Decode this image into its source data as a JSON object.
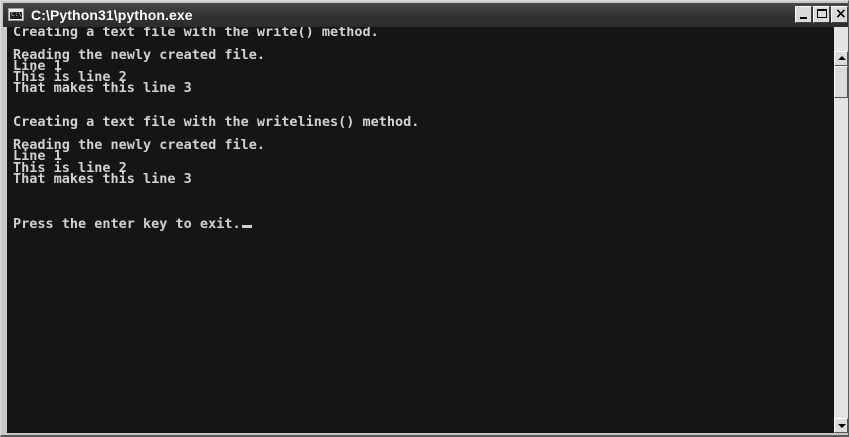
{
  "window": {
    "title": "C:\\Python31\\python.exe",
    "icon_name": "console-app-icon",
    "icon_text": "C:\\",
    "buttons": {
      "minimize_glyph": "",
      "maximize_glyph": "",
      "close_glyph": "×"
    }
  },
  "console": {
    "lines": [
      "Creating a text file with the write() method.",
      "",
      "Reading the newly created file.",
      "Line 1",
      "This is line 2",
      "That makes this line 3",
      "",
      "",
      "Creating a text file with the writelines() method.",
      "",
      "Reading the newly created file.",
      "Line 1",
      "This is line 2",
      "That makes this line 3",
      "",
      "",
      "",
      "Press the enter key to exit."
    ],
    "foreground": "#d2d2d2",
    "background": "#151515"
  },
  "scrollbar": {
    "up_icon": "arrow-up-icon",
    "down_icon": "arrow-down-icon"
  }
}
